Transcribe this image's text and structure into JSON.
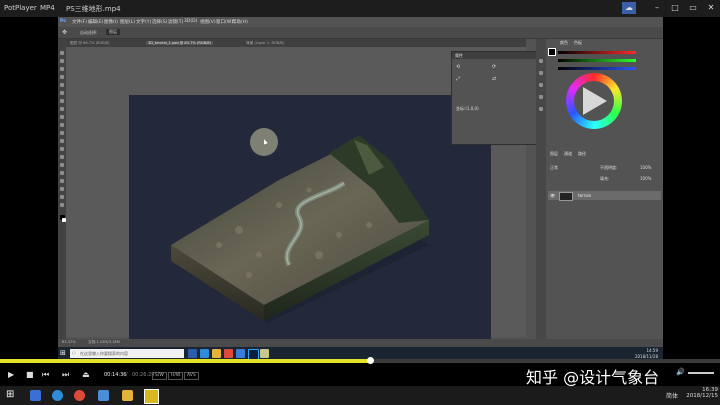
{
  "player": {
    "app_name": "PotPlayer",
    "format": "MP4",
    "file_title": "PS三维地形.mp4",
    "time_current": "00:14:36",
    "time_total": "00:26:29",
    "badges": [
      "S/W",
      "H/W",
      "AVS"
    ],
    "progress": 0.514
  },
  "photoshop": {
    "menu": [
      "文件(F)",
      "编辑(E)",
      "图像(I)",
      "图层(L)",
      "文字(Y)",
      "选择(S)",
      "滤镜(T)",
      "3D(D)",
      "视图(V)",
      "窗口(W)",
      "帮助(H)"
    ],
    "options_label": "自动选择:",
    "options_value": "图层",
    "tabs": [
      "图层 @ 66.7% (RGB/8)",
      "3D_terrain_1.psd @ 83.7% (RGB/8)",
      "背景 (Layer 1, RGB/8)"
    ],
    "zoom": "83.37%",
    "doc_info": "文档:1.25M/3.18M",
    "float_panel_title": "属性",
    "float_panel_value": "坐标:(1,0,0)",
    "right_tabs": [
      "颜色",
      "色板"
    ],
    "layers_tabs": [
      "图层",
      "通道",
      "路径"
    ],
    "blend_mode": "正常",
    "opacity_label": "不透明度:",
    "opacity_value": "100%",
    "fill_label": "填充:",
    "fill_value": "100%",
    "layer_name": "terrain",
    "search_placeholder": "在这里输入你要搜索的内容",
    "inner_clock_time": "14:59",
    "inner_clock_date": "2018/11/28"
  },
  "watermark": {
    "text": "知乎 @设计气象台"
  },
  "host": {
    "time": "16:39",
    "date": "2018/12/15",
    "ime": "简体"
  }
}
